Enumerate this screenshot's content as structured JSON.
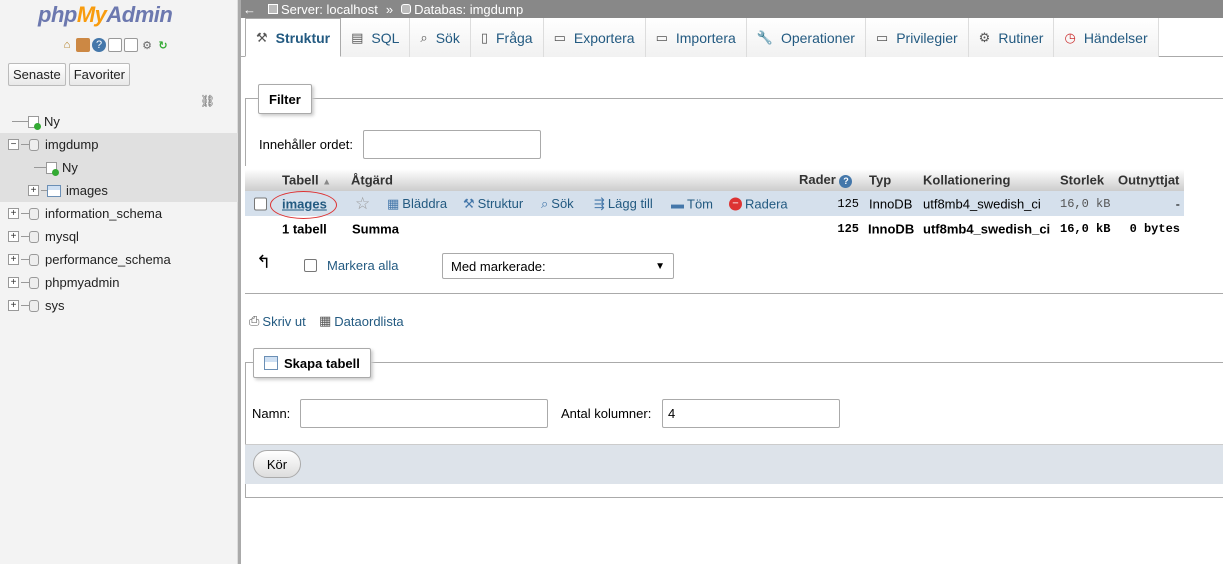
{
  "app": {
    "logo_php": "php",
    "logo_my": "My",
    "logo_admin": "Admin"
  },
  "sidebar": {
    "tabs": [
      "Senaste",
      "Favoriter"
    ],
    "tree": [
      {
        "label": "Ny",
        "kind": "new"
      },
      {
        "label": "imgdump",
        "kind": "db",
        "expanded": true
      },
      {
        "label": "Ny",
        "kind": "new-child"
      },
      {
        "label": "images",
        "kind": "table-child"
      },
      {
        "label": "information_schema",
        "kind": "db"
      },
      {
        "label": "mysql",
        "kind": "db"
      },
      {
        "label": "performance_schema",
        "kind": "db"
      },
      {
        "label": "phpmyadmin",
        "kind": "db"
      },
      {
        "label": "sys",
        "kind": "db"
      }
    ]
  },
  "breadcrumb": {
    "back": "←",
    "server": "Server: localhost",
    "separator": "»",
    "database": "Databas: imgdump"
  },
  "tabs": [
    "Struktur",
    "SQL",
    "Sök",
    "Fråga",
    "Exportera",
    "Importera",
    "Operationer",
    "Privilegier",
    "Rutiner",
    "Händelser"
  ],
  "filter": {
    "legend": "Filter",
    "label": "Innehåller ordet:",
    "value": ""
  },
  "table": {
    "headers": {
      "table": "Tabell",
      "action": "Åtgärd",
      "rows": "Rader",
      "type": "Typ",
      "collation": "Kollationering",
      "size": "Storlek",
      "overhead": "Outnyttjat"
    },
    "row": {
      "name": "images",
      "actions": [
        "Bläddra",
        "Struktur",
        "Sök",
        "Lägg till",
        "Töm",
        "Radera"
      ],
      "rows": "125",
      "type": "InnoDB",
      "collation": "utf8mb4_swedish_ci",
      "size": "16,0 kB",
      "overhead": "-"
    },
    "summary": {
      "name": "1 tabell",
      "action": "Summa",
      "rows": "125",
      "type": "InnoDB",
      "collation": "utf8mb4_swedish_ci",
      "size": "16,0 kB",
      "overhead": "0 bytes"
    }
  },
  "bulk": {
    "check_all": "Markera alla",
    "with_selected": "Med markerade:"
  },
  "links": {
    "print": "Skriv ut",
    "dictionary": "Dataordlista"
  },
  "create": {
    "legend": "Skapa tabell",
    "name_label": "Namn:",
    "name_value": "",
    "cols_label": "Antal kolumner:",
    "cols_value": "4",
    "go": "Kör"
  }
}
